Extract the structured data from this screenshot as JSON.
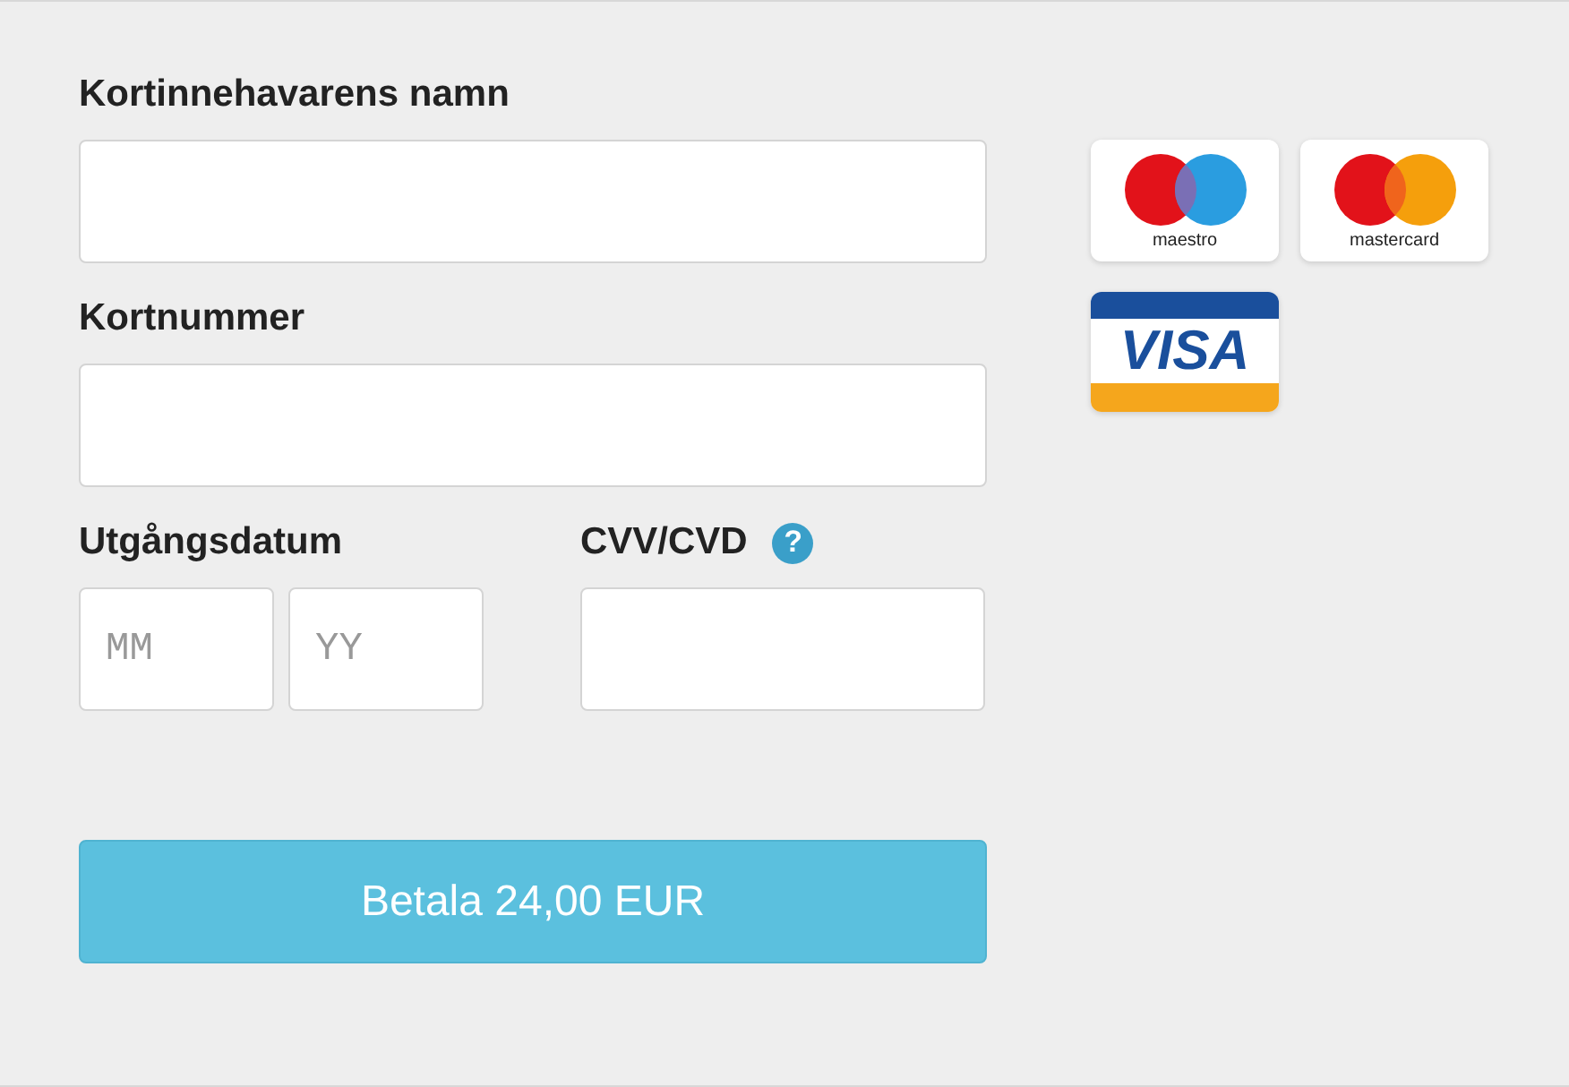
{
  "fields": [
    {
      "label": "Kortinnehavarens namn"
    },
    {
      "label": "Kortnummer"
    }
  ],
  "expiry": {
    "label": "Utgångsdatum",
    "month": {
      "placeholder": "MM"
    },
    "year": {
      "placeholder": "YY"
    }
  },
  "cvv": {
    "label": "CVV/CVD",
    "help": "?"
  },
  "pay_button": "Betala 24,00 EUR",
  "cards": [
    {
      "kind": "maestro",
      "name": "maestro"
    },
    {
      "kind": "mastercard",
      "name": "mastercard"
    },
    {
      "kind": "visa",
      "name": "VISA"
    }
  ]
}
